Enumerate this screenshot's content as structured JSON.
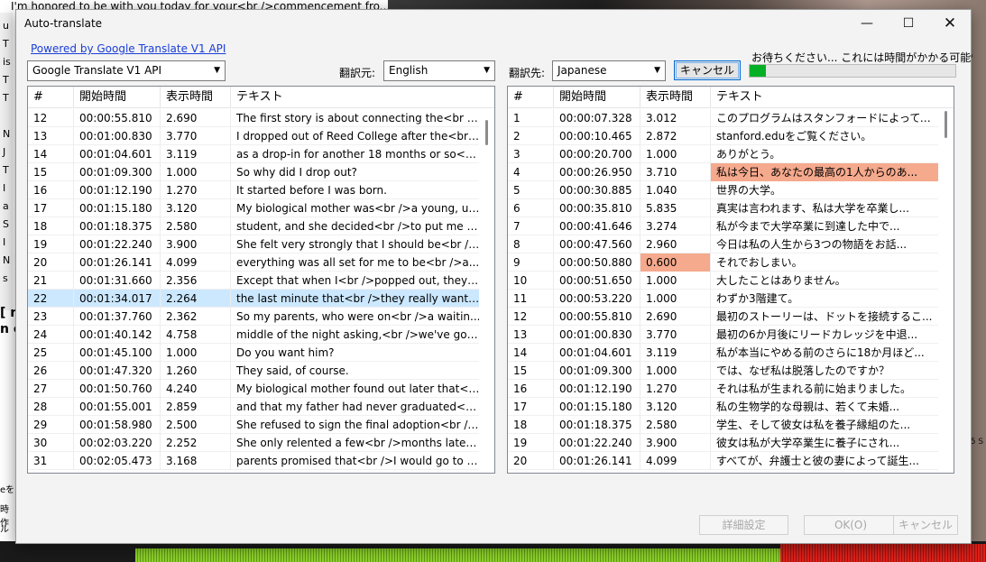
{
  "background": {
    "top_text": "I'm honored to be with you today for your<br />commencement fro...",
    "side_letters": [
      "u",
      "T",
      "is",
      "T",
      "T",
      "",
      "N",
      "J",
      "T",
      "I",
      "a",
      "S",
      "I",
      "N",
      "s"
    ],
    "bold_fragment": "[ n\nn c",
    "side_bits": [
      "eを",
      "時作",
      "ル"
    ],
    "right_fragment": "05 S"
  },
  "dialog": {
    "title": "Auto-translate",
    "powered_by": "Powered by Google Translate V1 API",
    "engine": "Google Translate V1 API",
    "source_label": "翻訳元:",
    "source_language": "English",
    "target_label": "翻訳先:",
    "target_language": "Japanese",
    "cancel_top": "キャンセル",
    "status": "お待ちください... これには時間がかかる可能性があり",
    "progress_fraction": 0.08,
    "buttons": {
      "settings": "詳細設定",
      "ok": "OK(O)",
      "cancel": "キャンセル"
    }
  },
  "columns": {
    "number": "#",
    "start": "開始時間",
    "duration": "表示時間",
    "text": "テキスト"
  },
  "source_rows": [
    {
      "n": "12",
      "start": "00:00:55.810",
      "dur": "2.690",
      "text": "The first story is about connecting the<br />..."
    },
    {
      "n": "13",
      "start": "00:01:00.830",
      "dur": "3.770",
      "text": "I dropped out of Reed College after the<br ..."
    },
    {
      "n": "14",
      "start": "00:01:04.601",
      "dur": "3.119",
      "text": "as a drop-in for another 18 months or so<b..."
    },
    {
      "n": "15",
      "start": "00:01:09.300",
      "dur": "1.000",
      "text": "So why did I drop out?"
    },
    {
      "n": "16",
      "start": "00:01:12.190",
      "dur": "1.270",
      "text": "It started before I was born."
    },
    {
      "n": "17",
      "start": "00:01:15.180",
      "dur": "3.120",
      "text": "My biological mother was<br />a young, un..."
    },
    {
      "n": "18",
      "start": "00:01:18.375",
      "dur": "2.580",
      "text": "student, and she decided<br />to put me u..."
    },
    {
      "n": "19",
      "start": "00:01:22.240",
      "dur": "3.900",
      "text": "She felt very strongly that I should be<br />..."
    },
    {
      "n": "20",
      "start": "00:01:26.141",
      "dur": "4.099",
      "text": "everything was all set for me to be<br />a..."
    },
    {
      "n": "21",
      "start": "00:01:31.660",
      "dur": "2.356",
      "text": "Except that when I<br />popped out, they ..."
    },
    {
      "n": "22",
      "start": "00:01:34.017",
      "dur": "2.264",
      "text": "the last minute that<br />they really wante...",
      "selected": true
    },
    {
      "n": "23",
      "start": "00:01:37.760",
      "dur": "2.362",
      "text": "So my parents, who were on<br />a waitin..."
    },
    {
      "n": "24",
      "start": "00:01:40.142",
      "dur": "4.758",
      "text": "middle of the night asking,<br />we've got ..."
    },
    {
      "n": "25",
      "start": "00:01:45.100",
      "dur": "1.000",
      "text": "Do you want him?"
    },
    {
      "n": "26",
      "start": "00:01:47.320",
      "dur": "1.260",
      "text": "They said, of course."
    },
    {
      "n": "27",
      "start": "00:01:50.760",
      "dur": "4.240",
      "text": "My biological mother found out later that<b..."
    },
    {
      "n": "28",
      "start": "00:01:55.001",
      "dur": "2.859",
      "text": "and that my father had never graduated<br..."
    },
    {
      "n": "29",
      "start": "00:01:58.980",
      "dur": "2.500",
      "text": "She refused to sign the final adoption<br />..."
    },
    {
      "n": "30",
      "start": "00:02:03.220",
      "dur": "2.252",
      "text": "She only relented a few<br />months later ..."
    },
    {
      "n": "31",
      "start": "00:02:05.473",
      "dur": "3.168",
      "text": "parents promised that<br />I would go to c..."
    }
  ],
  "target_rows": [
    {
      "n": "1",
      "start": "00:00:07.328",
      "dur": "3.012",
      "text": "このプログラムはスタンフォードによっても..."
    },
    {
      "n": "2",
      "start": "00:00:10.465",
      "dur": "2.872",
      "text": "stanford.eduをご覧ください。"
    },
    {
      "n": "3",
      "start": "00:00:20.700",
      "dur": "1.000",
      "text": "ありがとう。"
    },
    {
      "n": "4",
      "start": "00:00:26.950",
      "dur": "3.710",
      "text": "私は今日、あなたの最高の1人からのあ...",
      "text_hl": true
    },
    {
      "n": "5",
      "start": "00:00:30.885",
      "dur": "1.040",
      "text": "世界の大学。"
    },
    {
      "n": "6",
      "start": "00:00:35.810",
      "dur": "5.835",
      "text": "真実は言われます、私は大学を卒業し..."
    },
    {
      "n": "7",
      "start": "00:00:41.646",
      "dur": "3.274",
      "text": "私が今まで大学卒業に到達した中で..."
    },
    {
      "n": "8",
      "start": "00:00:47.560",
      "dur": "2.960",
      "text": "今日は私の人生から3つの物語をお話..."
    },
    {
      "n": "9",
      "start": "00:00:50.880",
      "dur": "0.600",
      "text": "それでおしまい。",
      "dur_hl": true
    },
    {
      "n": "10",
      "start": "00:00:51.650",
      "dur": "1.000",
      "text": "大したことはありません。"
    },
    {
      "n": "11",
      "start": "00:00:53.220",
      "dur": "1.000",
      "text": "わずか3階建て。"
    },
    {
      "n": "12",
      "start": "00:00:55.810",
      "dur": "2.690",
      "text": "最初のストーリーは、ドットを接続するこ..."
    },
    {
      "n": "13",
      "start": "00:01:00.830",
      "dur": "3.770",
      "text": "最初の6か月後にリードカレッジを中退..."
    },
    {
      "n": "14",
      "start": "00:01:04.601",
      "dur": "3.119",
      "text": "私が本当にやめる前のさらに18か月ほど..."
    },
    {
      "n": "15",
      "start": "00:01:09.300",
      "dur": "1.000",
      "text": "では、なぜ私は脱落したのですか？"
    },
    {
      "n": "16",
      "start": "00:01:12.190",
      "dur": "1.270",
      "text": "それは私が生まれる前に始まりました。"
    },
    {
      "n": "17",
      "start": "00:01:15.180",
      "dur": "3.120",
      "text": "私の生物学的な母親は、若くて未婚..."
    },
    {
      "n": "18",
      "start": "00:01:18.375",
      "dur": "2.580",
      "text": "学生、そして彼女は私を養子縁組のた..."
    },
    {
      "n": "19",
      "start": "00:01:22.240",
      "dur": "3.900",
      "text": "彼女は私が大学卒業生に養子にされ..."
    },
    {
      "n": "20",
      "start": "00:01:26.141",
      "dur": "4.099",
      "text": "すべてが、弁護士と彼の妻によって誕生..."
    }
  ]
}
